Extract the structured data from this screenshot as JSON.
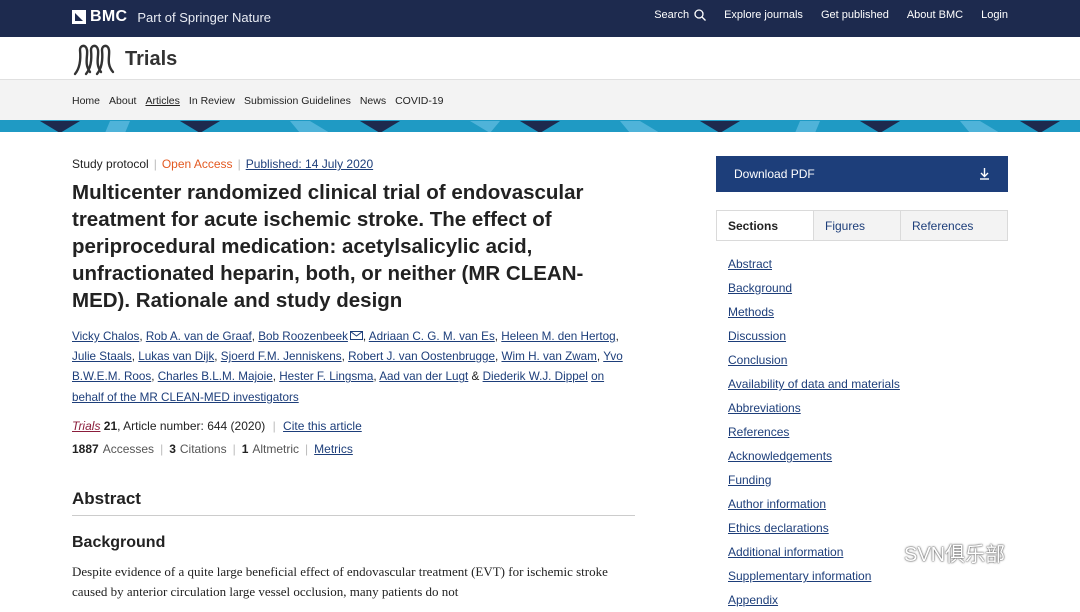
{
  "topbar": {
    "brand": "BMC",
    "brand_sub": "Part of Springer Nature",
    "nav": [
      "Search",
      "Explore journals",
      "Get published",
      "About BMC",
      "Login"
    ]
  },
  "journal": {
    "title": "Trials"
  },
  "subnav": [
    "Home",
    "About",
    "Articles",
    "In Review",
    "Submission Guidelines",
    "News",
    "COVID-19"
  ],
  "article": {
    "type": "Study protocol",
    "access": "Open Access",
    "published": "Published: 14 July 2020",
    "title": "Multicenter randomized clinical trial of endovascular treatment for acute ischemic stroke. The effect of periprocedural medication: acetylsalicylic acid, unfractionated heparin, both, or neither (MR CLEAN-MED). Rationale and study design",
    "authors": [
      "Vicky Chalos",
      "Rob A. van de Graaf",
      "Bob Roozenbeek",
      "Adriaan C. G. M. van Es",
      "Heleen M. den Hertog",
      "Julie Staals",
      "Lukas van Dijk",
      "Sjoerd F.M. Jenniskens",
      "Robert J. van Oostenbrugge",
      "Wim H. van Zwam",
      "Yvo B.W.E.M. Roos",
      "Charles B.L.M. Majoie",
      "Hester F. Lingsma",
      "Aad van der Lugt",
      "Diederik W.J. Dippel"
    ],
    "authors_and": "&",
    "group": "on behalf of the MR CLEAN-MED investigators",
    "journal_ref": "Trials",
    "volume": "21",
    "article_number": ", Article number: 644 (2020)",
    "cite_label": "Cite this article",
    "accesses_num": "1887",
    "accesses_label": "Accesses",
    "citations_num": "3",
    "citations_label": "Citations",
    "altmetric_num": "1",
    "altmetric_label": "Altmetric",
    "metrics_link": "Metrics",
    "abstract_heading": "Abstract",
    "background_heading": "Background",
    "background_text": "Despite evidence of a quite large beneficial effect of endovascular treatment (EVT) for ischemic stroke caused by anterior circulation large vessel occlusion, many patients do not"
  },
  "sidebar": {
    "download": "Download PDF",
    "tabs": [
      "Sections",
      "Figures",
      "References"
    ],
    "sections": [
      "Abstract",
      "Background",
      "Methods",
      "Discussion",
      "Conclusion",
      "Availability of data and materials",
      "Abbreviations",
      "References",
      "Acknowledgements",
      "Funding",
      "Author information",
      "Ethics declarations",
      "Additional information",
      "Supplementary information",
      "Appendix"
    ]
  },
  "watermark": "SVN俱乐部",
  "colors": {
    "topbar": "#1d2a4e",
    "primary": "#1d3e7a",
    "open_access": "#e35a22",
    "stripe": "#1f9ac4"
  }
}
